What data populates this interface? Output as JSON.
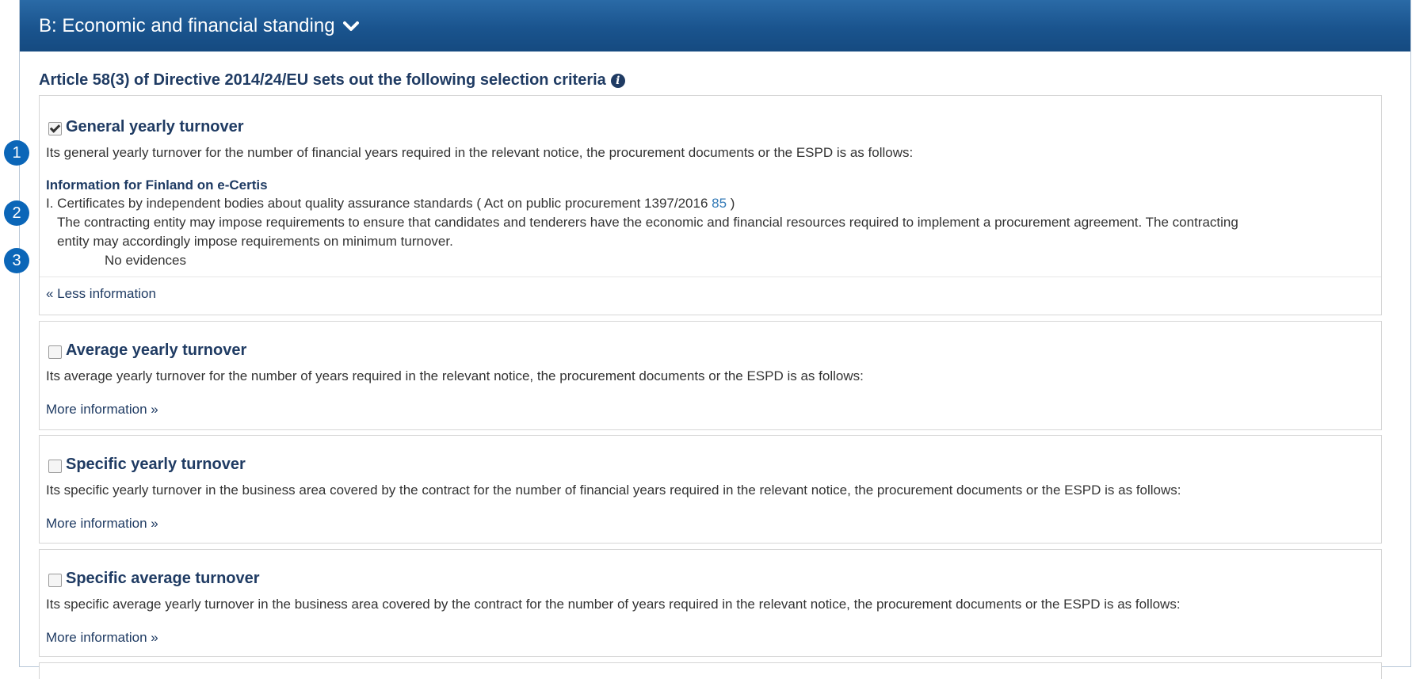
{
  "header": {
    "title": "B: Economic and financial standing",
    "chevron": "chevron-down-icon"
  },
  "intro": {
    "text": "Article 58(3) of Directive 2014/24/EU sets out the following selection criteria",
    "icon": "info-icon"
  },
  "badges": [
    "1",
    "2",
    "3"
  ],
  "criteria": [
    {
      "title": "General yearly turnover",
      "checked": true,
      "description": "Its general yearly turnover for the number of financial years required in the relevant notice, the procurement documents or the ESPD is as follows:",
      "details": {
        "heading": "Information for Finland on e-Certis",
        "item_prefix": "I. Certificates by independent bodies about quality assurance standards ( Act on public procurement 1397/2016 ",
        "item_link": "85",
        "item_suffix": " )",
        "text_line1": "The contracting entity may impose requirements to ensure that candidates and tenderers have the economic and financial resources required to implement a procurement agreement. The contracting",
        "text_line2": "entity may accordingly impose requirements on minimum turnover.",
        "evidence": "No evidences"
      },
      "toggle": "« Less information"
    },
    {
      "title": "Average yearly turnover",
      "checked": false,
      "description": "Its average yearly turnover for the number of years required in the relevant notice, the procurement documents or the ESPD is as follows:",
      "toggle": "More information »"
    },
    {
      "title": "Specific yearly turnover",
      "checked": false,
      "description": "Its specific yearly turnover in the business area covered by the contract for the number of financial years required in the relevant notice, the procurement documents or the ESPD is as follows:",
      "toggle": "More information »"
    },
    {
      "title": "Specific average turnover",
      "checked": false,
      "description": "Its specific average yearly turnover in the business area covered by the contract for the number of years required in the relevant notice, the procurement documents or the ESPD is as follows:",
      "toggle": "More information »"
    }
  ]
}
